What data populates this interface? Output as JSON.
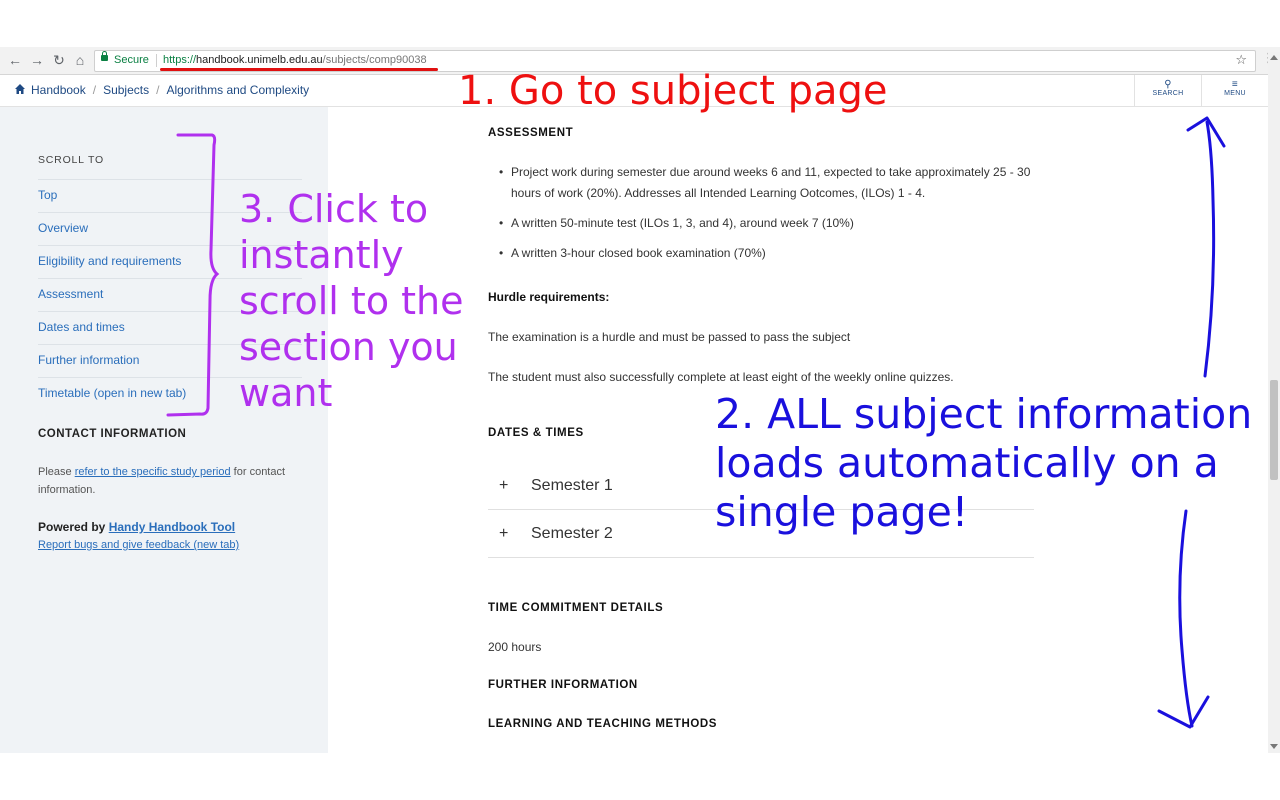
{
  "browser": {
    "secure_label": "Secure",
    "url_protocol": "https://",
    "url_host": "handbook.unimelb.edu.au",
    "url_path": "/subjects/comp90038"
  },
  "header": {
    "breadcrumb": [
      "Handbook",
      "Subjects",
      "Algorithms and Complexity"
    ],
    "search_label": "SEARCH",
    "menu_label": "MENU"
  },
  "sidebar": {
    "scroll_title": "SCROLL TO",
    "items": [
      "Top",
      "Overview",
      "Eligibility and requirements",
      "Assessment",
      "Dates and times",
      "Further information",
      "Timetable (open in new tab)"
    ],
    "contact_title": "CONTACT INFORMATION",
    "contact_prefix": "Please ",
    "contact_link": "refer to the specific study period",
    "contact_suffix": " for contact information.",
    "powered_prefix": "Powered by ",
    "powered_link": "Handy Handbook Tool",
    "report_link": "Report bugs and give feedback (new tab)"
  },
  "main": {
    "assessment_title": "ASSESSMENT",
    "assessment_items": [
      "Project work during semester due around weeks 6 and 11, expected to take approximately 25 - 30 hours of work (20%). Addresses all Intended Learning Ootcomes, (ILOs) 1 - 4.",
      "A written 50-minute test (ILOs 1, 3, and 4), around week 7 (10%)",
      "A written 3-hour closed book examination (70%)"
    ],
    "hurdle_title": "Hurdle requirements:",
    "hurdle_text_1": "The examination is a hurdle and must be passed to pass the subject",
    "hurdle_text_2": "The student must also successfully complete at least eight of the weekly online quizzes.",
    "dates_title": "DATES & TIMES",
    "semesters": [
      "Semester 1",
      "Semester 2"
    ],
    "time_title": "TIME COMMITMENT DETAILS",
    "time_value": "200 hours",
    "further_title": "FURTHER INFORMATION",
    "learning_title": "LEARNING AND TEACHING METHODS"
  },
  "annotations": {
    "step1": "1. Go to subject page",
    "step2": "2. ALL subject information loads automatically on a single page!",
    "step3": "3. Click to instantly scroll to the section you want"
  }
}
